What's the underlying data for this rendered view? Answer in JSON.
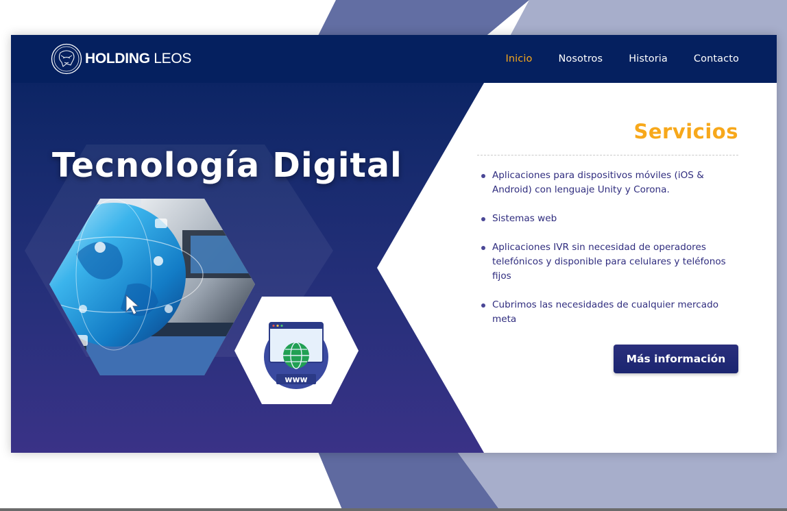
{
  "brand": {
    "name_bold": "HOLDING",
    "name_light": " LEOS"
  },
  "nav": {
    "items": [
      {
        "label": "Inicio",
        "active": true
      },
      {
        "label": "Nosotros",
        "active": false
      },
      {
        "label": "Historia",
        "active": false
      },
      {
        "label": "Contacto",
        "active": false
      }
    ]
  },
  "hero": {
    "title": "Tecnología Digital",
    "badge_text": "www"
  },
  "services": {
    "title": "Servicios",
    "items": [
      "Aplicaciones para dispositivos móviles (iOS & Android) con lenguaje Unity y Corona.",
      "Sistemas web",
      "Aplicaciones IVR sin necesidad de operadores telefónicos y disponible para celulares y teléfonos fijos",
      "Cubrimos las necesidades de cualquier mercado meta"
    ],
    "button_label": "Más información"
  },
  "colors": {
    "navy": "#05205f",
    "indigo": "#3a3287",
    "accent": "#f7a81b",
    "text_purple": "#2f2c7e"
  }
}
